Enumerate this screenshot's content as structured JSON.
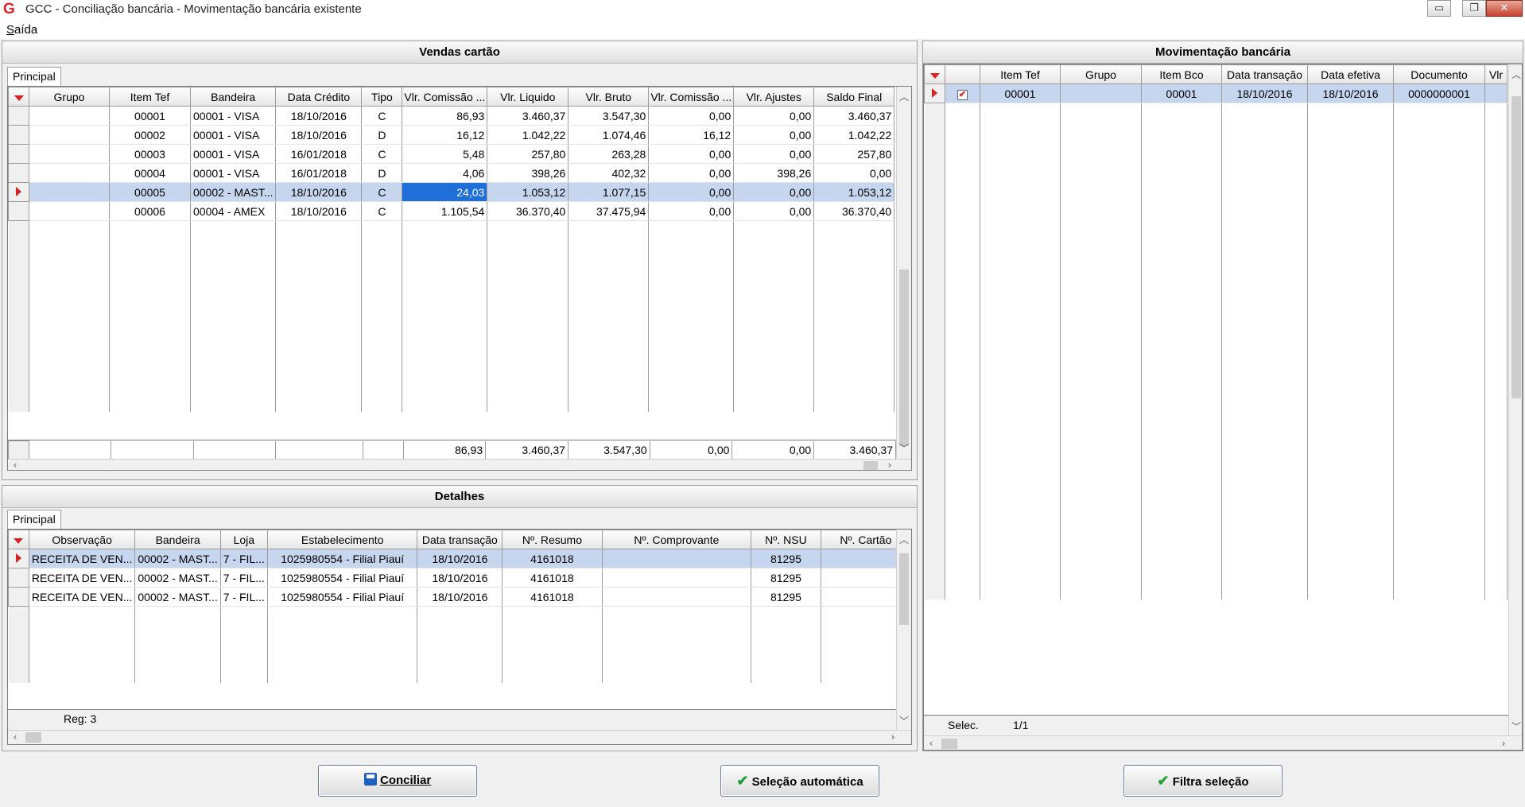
{
  "window": {
    "title": "GCC - Conciliação bancária - Movimentação bancária existente",
    "minimize_label": "▭",
    "restore_label": "❐",
    "close_label": "✕"
  },
  "menu": {
    "saida": "Saída"
  },
  "vendas": {
    "title": "Vendas cartão",
    "tab": "Principal",
    "columns": [
      "Grupo",
      "Item Tef",
      "Bandeira",
      "Data Crédito",
      "Tipo",
      "Vlr. Comissão ...",
      "Vlr. Liquido",
      "Vlr. Bruto",
      "Vlr. Comissão ...",
      "Vlr. Ajustes",
      "Saldo Final"
    ],
    "rows": [
      [
        "",
        "00001",
        "00001 - VISA",
        "18/10/2016",
        "C",
        "86,93",
        "3.460,37",
        "3.547,30",
        "0,00",
        "0,00",
        "3.460,37"
      ],
      [
        "",
        "00002",
        "00001 - VISA",
        "18/10/2016",
        "D",
        "16,12",
        "1.042,22",
        "1.074,46",
        "16,12",
        "0,00",
        "1.042,22"
      ],
      [
        "",
        "00003",
        "00001 - VISA",
        "16/01/2018",
        "C",
        "5,48",
        "257,80",
        "263,28",
        "0,00",
        "0,00",
        "257,80"
      ],
      [
        "",
        "00004",
        "00001 - VISA",
        "16/01/2018",
        "D",
        "4,06",
        "398,26",
        "402,32",
        "0,00",
        "398,26",
        "0,00"
      ],
      [
        "",
        "00005",
        "00002 - MAST...",
        "18/10/2016",
        "C",
        "24,03",
        "1.053,12",
        "1.077,15",
        "0,00",
        "0,00",
        "1.053,12"
      ],
      [
        "",
        "00006",
        "00004 - AMEX",
        "18/10/2016",
        "C",
        "1.105,54",
        "36.370,40",
        "37.475,94",
        "0,00",
        "0,00",
        "36.370,40"
      ]
    ],
    "selected_row": 4,
    "footer": [
      "",
      "",
      "",
      "",
      "",
      "86,93",
      "3.460,37",
      "3.547,30",
      "0,00",
      "0,00",
      "3.460,37"
    ]
  },
  "detalhes": {
    "title": "Detalhes",
    "tab": "Principal",
    "columns": [
      "Observação",
      "Bandeira",
      "Loja",
      "Estabelecimento",
      "Data transação",
      "Nº. Resumo",
      "Nº. Comprovante",
      "Nº. NSU",
      "Nº. Cartão"
    ],
    "rows": [
      [
        "RECEITA DE VEN...",
        "00002 - MAST...",
        "7 - FIL...",
        "1025980554 - Filial Piauí",
        "18/10/2016",
        "4161018",
        "",
        "81295",
        ""
      ],
      [
        "RECEITA DE VEN...",
        "00002 - MAST...",
        "7 - FIL...",
        "1025980554 - Filial Piauí",
        "18/10/2016",
        "4161018",
        "",
        "81295",
        ""
      ],
      [
        "RECEITA DE VEN...",
        "00002 - MAST...",
        "7 - FIL...",
        "1025980554 - Filial Piauí",
        "18/10/2016",
        "4161018",
        "",
        "81295",
        ""
      ]
    ],
    "selected_row": 0,
    "footer": "Reg: 3"
  },
  "movimentacao": {
    "title": "Movimentação bancária",
    "columns": [
      "",
      "Item Tef",
      "Grupo",
      "Item Bco",
      "Data transação",
      "Data efetiva",
      "Documento",
      "Vlr"
    ],
    "rows": [
      [
        true,
        "00001",
        "",
        "00001",
        "18/10/2016",
        "18/10/2016",
        "0000000001",
        ""
      ]
    ],
    "footer_label": "Selec.",
    "footer_value": "1/1"
  },
  "buttons": {
    "conciliar": "Conciliar",
    "selecao_automatica": "Seleção automática",
    "filtra_selecao": "Filtra seleção"
  },
  "colors": {
    "accent_red": "#d52121",
    "selection": "#c5d6ee",
    "focus": "#1e6fd9",
    "check_green": "#22a33a",
    "save_blue": "#1f5fbf"
  }
}
